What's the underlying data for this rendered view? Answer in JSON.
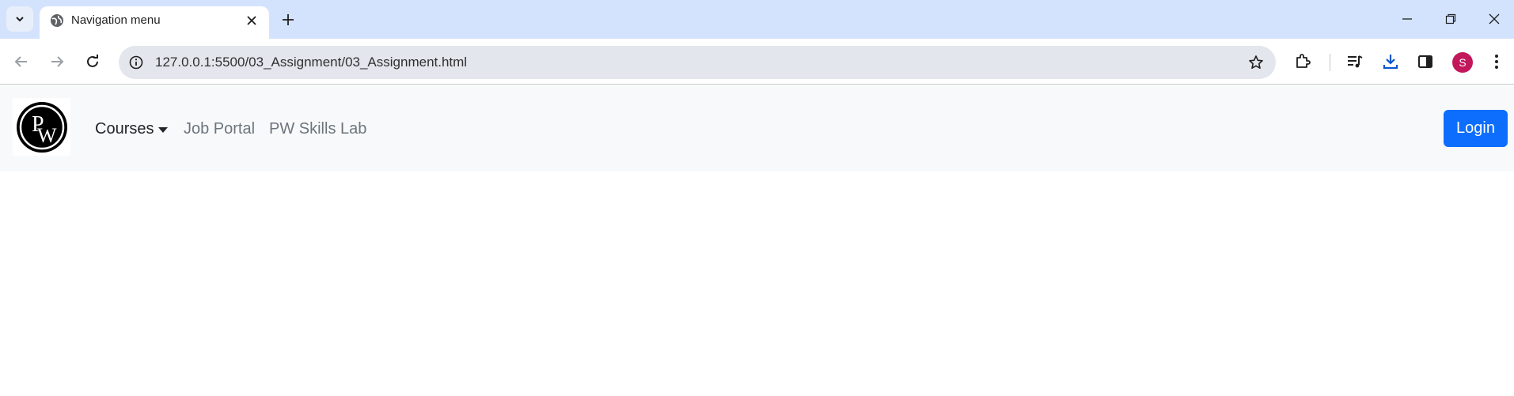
{
  "browser": {
    "tab": {
      "title": "Navigation menu",
      "favicon": "globe-icon"
    },
    "address_bar": {
      "url": "127.0.0.1:5500/03_Assignment/03_Assignment.html"
    },
    "profile_initial": "S",
    "colors": {
      "tabstrip": "#d3e3fd",
      "avatar": "#c2185b"
    }
  },
  "page": {
    "navbar": {
      "brand": {
        "logo_letters": "PW"
      },
      "links": [
        {
          "label": "Courses",
          "has_dropdown": true,
          "active": true
        },
        {
          "label": "Job Portal"
        },
        {
          "label": "PW Skills Lab"
        }
      ],
      "login_label": "Login"
    },
    "colors": {
      "primary": "#0d6efd",
      "navbar_bg": "#f8f9fa",
      "link_muted": "#6c757d"
    }
  }
}
